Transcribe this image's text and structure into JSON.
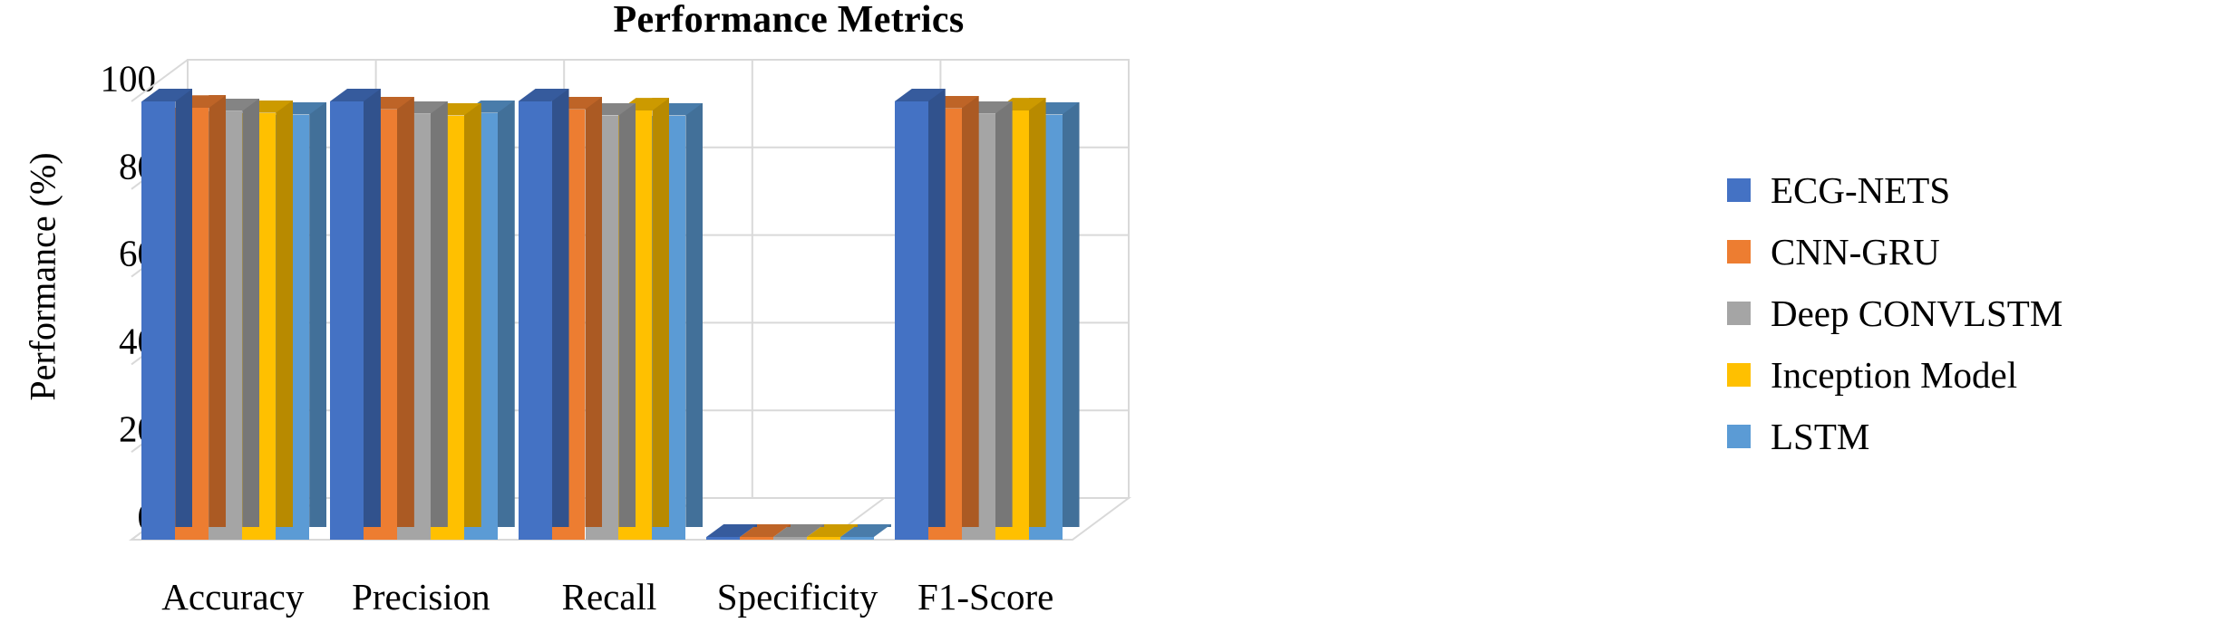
{
  "chart_data": {
    "type": "bar",
    "title": "Performance Metrics",
    "xlabel": "",
    "ylabel": "Performance (%)",
    "ylim": [
      0,
      100
    ],
    "yticks": [
      0,
      20,
      40,
      60,
      80,
      100
    ],
    "grid": true,
    "legend_position": "right",
    "style": "3d-clustered-column",
    "categories": [
      "Accuracy",
      "Precision",
      "Recall",
      "Specificity",
      "F1-Score"
    ],
    "series": [
      {
        "name": "ECG-NETS",
        "color": "#4472C4",
        "values": [
          100.0,
          100.0,
          100.0,
          0.0,
          100.0
        ]
      },
      {
        "name": "CNN-GRU",
        "color": "#ED7D31",
        "values": [
          98.5,
          98.2,
          98.2,
          0.0,
          98.4
        ]
      },
      {
        "name": "Deep CONVLSTM",
        "color": "#A5A5A5",
        "values": [
          97.8,
          97.2,
          96.8,
          0.0,
          97.2
        ]
      },
      {
        "name": "Inception Model",
        "color": "#FFC000",
        "values": [
          97.4,
          96.8,
          97.9,
          0.0,
          97.9
        ]
      },
      {
        "name": "LSTM",
        "color": "#5B9BD5",
        "values": [
          97.0,
          97.4,
          96.8,
          0.0,
          97.0
        ]
      }
    ]
  },
  "legend": {
    "items": [
      {
        "label": "ECG-NETS",
        "color": "#4472C4"
      },
      {
        "label": "CNN-GRU",
        "color": "#ED7D31"
      },
      {
        "label": "Deep CONVLSTM",
        "color": "#A5A5A5"
      },
      {
        "label": "Inception Model",
        "color": "#FFC000"
      },
      {
        "label": "LSTM",
        "color": "#5B9BD5"
      }
    ]
  },
  "axes": {
    "y_title": "Performance (%)",
    "y_tick_labels": [
      "100",
      "80",
      "60",
      "40",
      "20",
      "0"
    ],
    "x_tick_labels": [
      "Accuracy",
      "Precision",
      "Recall",
      "Specificity",
      "F1-Score"
    ]
  },
  "colors": {
    "grid": "#D9D9D9",
    "axis": "#BFBFBF",
    "wall": "#FFFFFF",
    "text": "#000000"
  }
}
